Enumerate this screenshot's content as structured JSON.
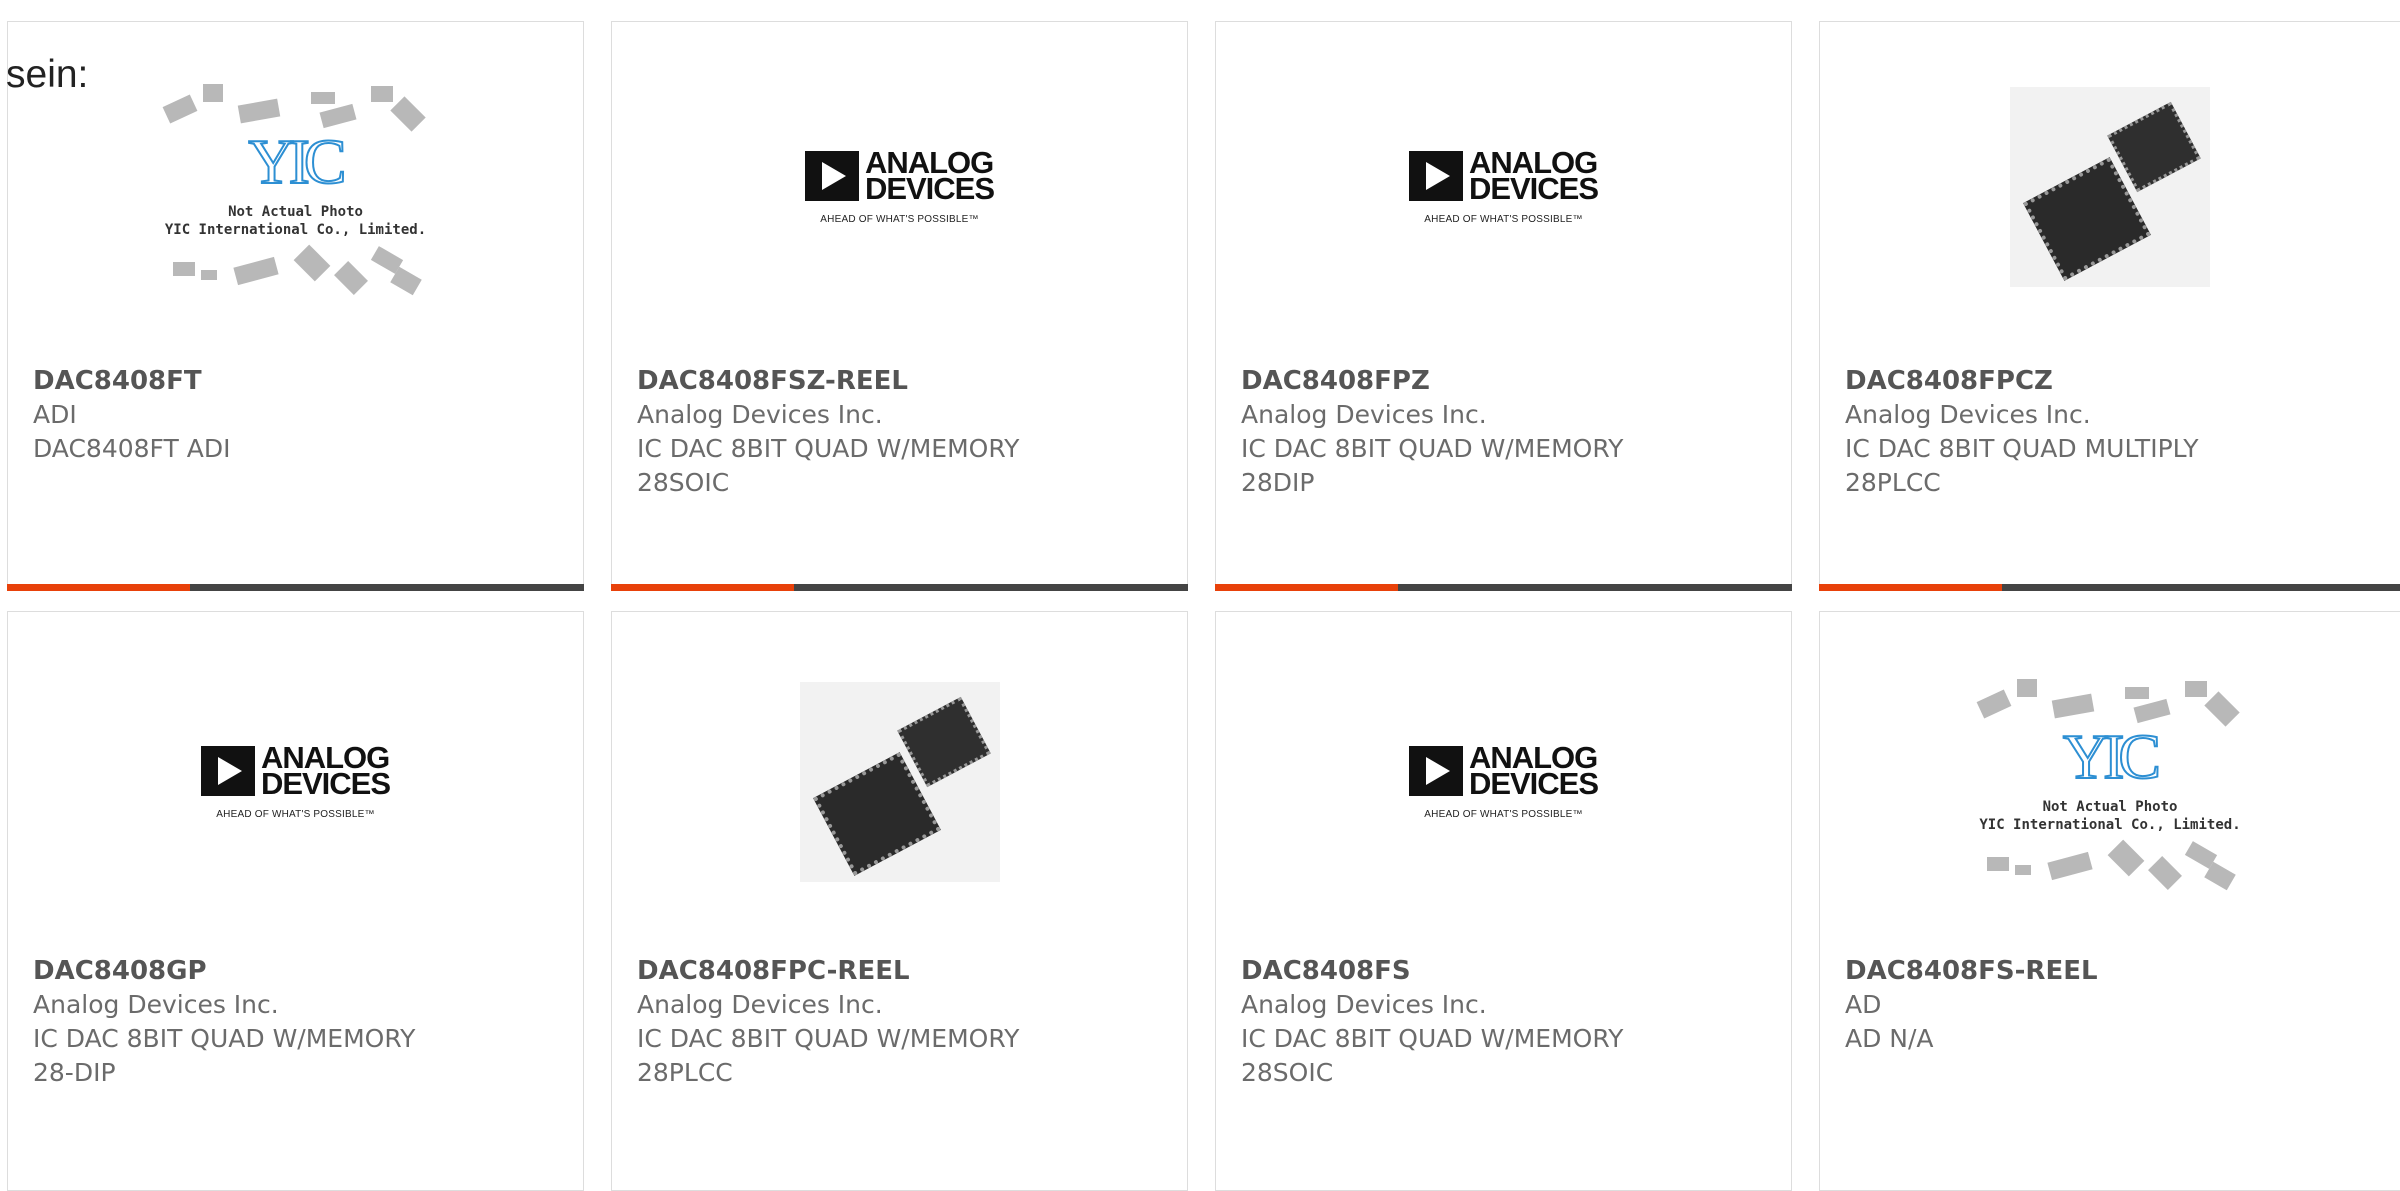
{
  "intro_text": "sein:",
  "colors": {
    "accent": "#e8410a",
    "bar": "#444444",
    "border": "#dddddd"
  },
  "analog_logo": {
    "line1": "ANALOG",
    "line2": "DEVICES",
    "tagline": "AHEAD OF WHAT'S POSSIBLE™"
  },
  "yic_placeholder": {
    "line1": "Not Actual Photo",
    "line2": "YIC International Co., Limited."
  },
  "products": [
    {
      "part": "DAC8408FT",
      "manufacturer": "ADI",
      "desc1": "DAC8408FT ADI",
      "desc2": "",
      "image": "yic-placeholder"
    },
    {
      "part": "DAC8408FSZ-REEL",
      "manufacturer": "Analog Devices Inc.",
      "desc1": "IC DAC 8BIT QUAD W/MEMORY",
      "desc2": "28SOIC",
      "image": "analog-devices-logo"
    },
    {
      "part": "DAC8408FPZ",
      "manufacturer": "Analog Devices Inc.",
      "desc1": "IC DAC 8BIT QUAD W/MEMORY",
      "desc2": "28DIP",
      "image": "analog-devices-logo"
    },
    {
      "part": "DAC8408FPCZ",
      "manufacturer": "Analog Devices Inc.",
      "desc1": "IC DAC 8BIT QUAD MULTIPLY",
      "desc2": "28PLCC",
      "image": "plcc-chip-photo"
    },
    {
      "part": "DAC8408GP",
      "manufacturer": "Analog Devices Inc.",
      "desc1": "IC DAC 8BIT QUAD W/MEMORY",
      "desc2": "28-DIP",
      "image": "analog-devices-logo"
    },
    {
      "part": "DAC8408FPC-REEL",
      "manufacturer": "Analog Devices Inc.",
      "desc1": "IC DAC 8BIT QUAD W/MEMORY",
      "desc2": "28PLCC",
      "image": "plcc-chip-photo"
    },
    {
      "part": "DAC8408FS",
      "manufacturer": "Analog Devices Inc.",
      "desc1": "IC DAC 8BIT QUAD W/MEMORY",
      "desc2": "28SOIC",
      "image": "analog-devices-logo"
    },
    {
      "part": "DAC8408FS-REEL",
      "manufacturer": "AD",
      "desc1": "AD N/A",
      "desc2": "",
      "image": "yic-placeholder"
    }
  ]
}
